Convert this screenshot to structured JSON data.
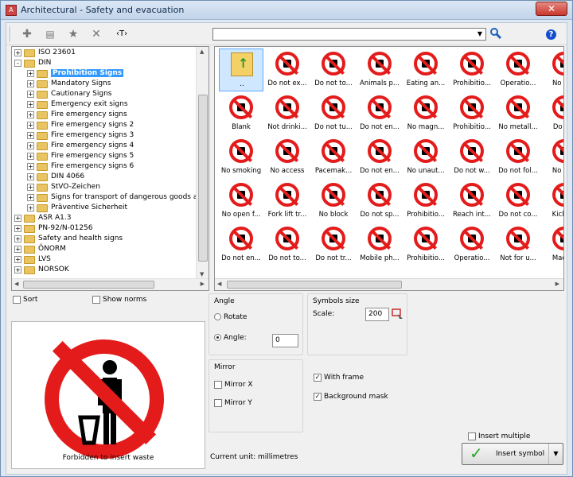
{
  "window": {
    "title": "Architectural - Safety and evacuation",
    "close_label": "✕"
  },
  "toolbar": {
    "text_tool_label": "‹T›",
    "search_value": "",
    "help_label": "?"
  },
  "tree": {
    "items": [
      {
        "label": "ISO 23601",
        "expanded": "+"
      },
      {
        "label": "DIN",
        "expanded": "-"
      },
      {
        "label": "Prohibition Signs",
        "expanded": "+",
        "selected": "true"
      },
      {
        "label": "Mandatory Signs",
        "expanded": "+"
      },
      {
        "label": "Cautionary Signs",
        "expanded": "+"
      },
      {
        "label": "Emergency exit signs",
        "expanded": "+"
      },
      {
        "label": "Fire emergency signs",
        "expanded": "+"
      },
      {
        "label": "Fire emergency signs 2",
        "expanded": "+"
      },
      {
        "label": "Fire emergency signs 3",
        "expanded": "+"
      },
      {
        "label": "Fire emergency signs 4",
        "expanded": "+"
      },
      {
        "label": "Fire emergency signs 5",
        "expanded": "+"
      },
      {
        "label": "Fire emergency signs 6",
        "expanded": "+"
      },
      {
        "label": "DIN 4066",
        "expanded": "+"
      },
      {
        "label": "StVO-Zeichen",
        "expanded": "+"
      },
      {
        "label": "Signs for transport of dangerous goods and fir",
        "expanded": "+"
      },
      {
        "label": "Präventive Sicherheit",
        "expanded": "+"
      },
      {
        "label": "ASR A1.3",
        "expanded": "+"
      },
      {
        "label": "PN-92/N-01256",
        "expanded": "+"
      },
      {
        "label": "Safety and health signs",
        "expanded": "+"
      },
      {
        "label": "ÖNORM",
        "expanded": "+"
      },
      {
        "label": "LVS",
        "expanded": "+"
      },
      {
        "label": "NORSOK",
        "expanded": "+"
      }
    ]
  },
  "grid": {
    "items": [
      "..",
      "Do not ex...",
      "Do not to...",
      "Animals p...",
      "Eating an...",
      "Prohibitio...",
      "Operatio...",
      "No nee",
      "Blank",
      "Not drinki...",
      "Do not tu...",
      "Do not en...",
      "No magn...",
      "Prohibitio...",
      "No metall...",
      "Do not",
      "No smoking",
      "No access",
      "Pacemak...",
      "Do not en...",
      "No unaut...",
      "Do not w...",
      "Do not fol...",
      "No pho",
      "No open f...",
      "Fork lift tr...",
      "No block",
      "Do not sp...",
      "Prohibitio...",
      "Reach int...",
      "Do not co...",
      "Kicking",
      "Do not en...",
      "Do not to...",
      "Do not tr...",
      "Mobile ph...",
      "Prohibitio...",
      "Operatio...",
      "Not for u...",
      "Machin"
    ]
  },
  "options": {
    "sort_label": "Sort",
    "show_norms_label": "Show norms",
    "preview_caption": "Forbidden to insert waste",
    "angle_group": "Angle",
    "rotate_label": "Rotate",
    "angle_label": "Angle:",
    "angle_value": "0",
    "size_group": "Symbols size",
    "scale_label": "Scale:",
    "scale_value": "200",
    "mirror_group": "Mirror",
    "mirror_x": "Mirror X",
    "mirror_y": "Mirror Y",
    "with_frame": "With frame",
    "background_mask": "Background mask",
    "current_unit": "Current unit: millimetres",
    "insert_multiple": "Insert multiple",
    "insert_symbol": "Insert symbol"
  },
  "colors": {
    "accent": "#3399ff",
    "prohibition_red": "#e41b1b",
    "confirm_green": "#27a81f"
  }
}
